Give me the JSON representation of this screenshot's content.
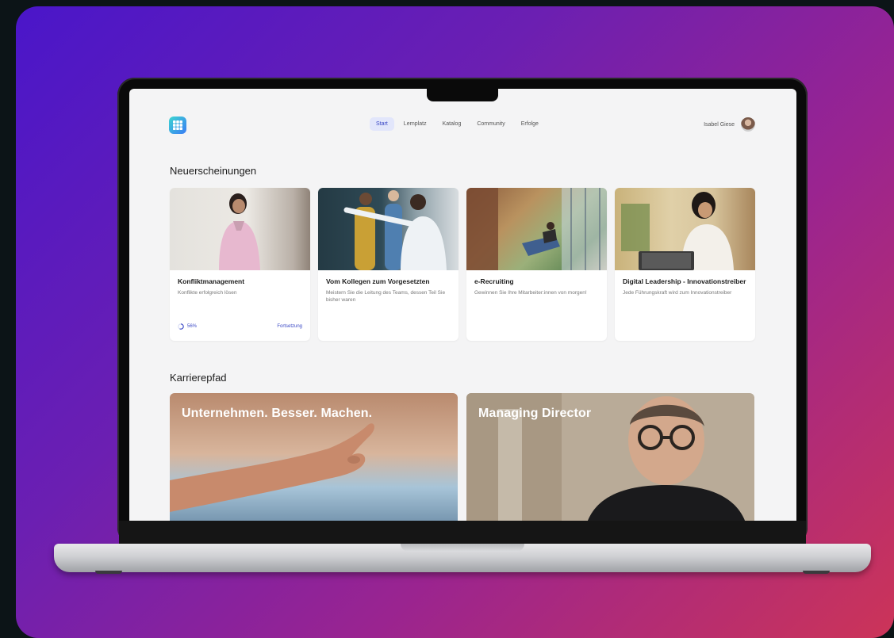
{
  "nav": {
    "items": [
      {
        "label": "Start",
        "active": true
      },
      {
        "label": "Lernplatz"
      },
      {
        "label": "Katalog"
      },
      {
        "label": "Community"
      },
      {
        "label": "Erfolge"
      }
    ]
  },
  "user": {
    "name": "Isabel Giese",
    "icon": "avatar"
  },
  "logo": {
    "icon": "grid-logo-icon"
  },
  "sections": {
    "new_releases": "Neuerscheinungen",
    "career_path": "Karrierepfad"
  },
  "cards": [
    {
      "title": "Konfliktmanagement",
      "subtitle": "Konflikte erfolgreich lösen",
      "progress": "56%",
      "progress_value": 0.56,
      "action": "Fortsetzung"
    },
    {
      "title": "Vom Kollegen zum Vorgesetzten",
      "subtitle": "Meistern Sie die Leitung des Teams, dessen Teil Sie bisher waren"
    },
    {
      "title": "e-Recruiting",
      "subtitle": "Gewinnen Sie Ihre Mitarbeiter:innen von morgen!"
    },
    {
      "title": "Digital Leadership - Innovationstreiber",
      "subtitle": "Jede Führungskraft wird zum Innovationstreiber"
    }
  ],
  "career": [
    {
      "title": "Unternehmen. Besser. Machen."
    },
    {
      "title": "Managing Director"
    }
  ],
  "colors": {
    "accent": "#3947c5",
    "gradient_start": "#4a16c9",
    "gradient_end": "#cc3458"
  }
}
